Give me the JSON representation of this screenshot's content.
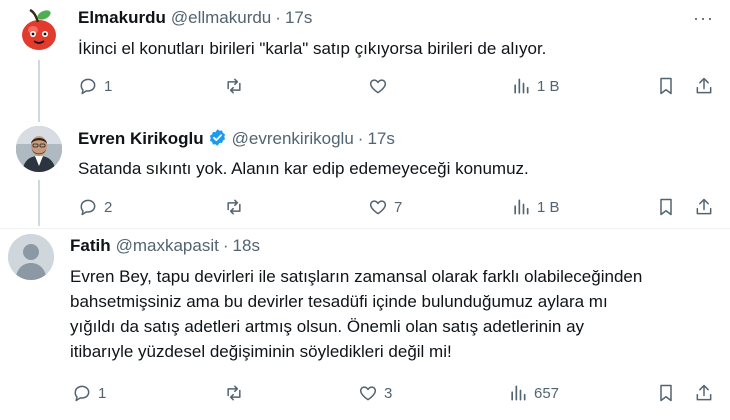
{
  "tweets": [
    {
      "name": "Elmakurdu",
      "handle": "@ellmakurdu",
      "separator": "·",
      "time": "17s",
      "text": "İkinci el konutları birileri \"karla\" satıp çıkıyorsa birileri de alıyor.",
      "replies": "1",
      "retweets": "",
      "likes": "",
      "views": "1 B"
    },
    {
      "name": "Evren Kirikoglu",
      "handle": "@evrenkirikoglu",
      "separator": "·",
      "time": "17s",
      "verified": true,
      "text": "Satanda sıkıntı yok. Alanın kar edip edemeyeceği konumuz.",
      "replies": "2",
      "retweets": "",
      "likes": "7",
      "views": "1 B"
    },
    {
      "name": "Fatih",
      "handle": "@maxkapasit",
      "separator": "·",
      "time": "18s",
      "text_lines": [
        "Evren Bey, tapu devirleri ile satışların zamansal olarak farklı olabileceğinden",
        "bahsetmişsiniz ama bu devirler tesadüfi içinde bulunduğumuz aylara mı",
        "yığıldı da satış adetleri artmış olsun. Önemli olan satış adetlerinin ay",
        "itibarıyle yüzdesel değişiminin söyledikleri değil mi!"
      ],
      "replies": "1",
      "retweets": "",
      "likes": "3",
      "views": "657"
    }
  ],
  "more_label": "···",
  "colors": {
    "text": "#0f1419",
    "muted": "#536471",
    "verified": "#1d9bf0",
    "line": "#cfd9de"
  },
  "icons": [
    "apple-avatar",
    "reply-icon",
    "retweet-icon",
    "like-icon",
    "views-icon",
    "bookmark-icon",
    "share-icon",
    "verified-icon",
    "more-icon"
  ]
}
